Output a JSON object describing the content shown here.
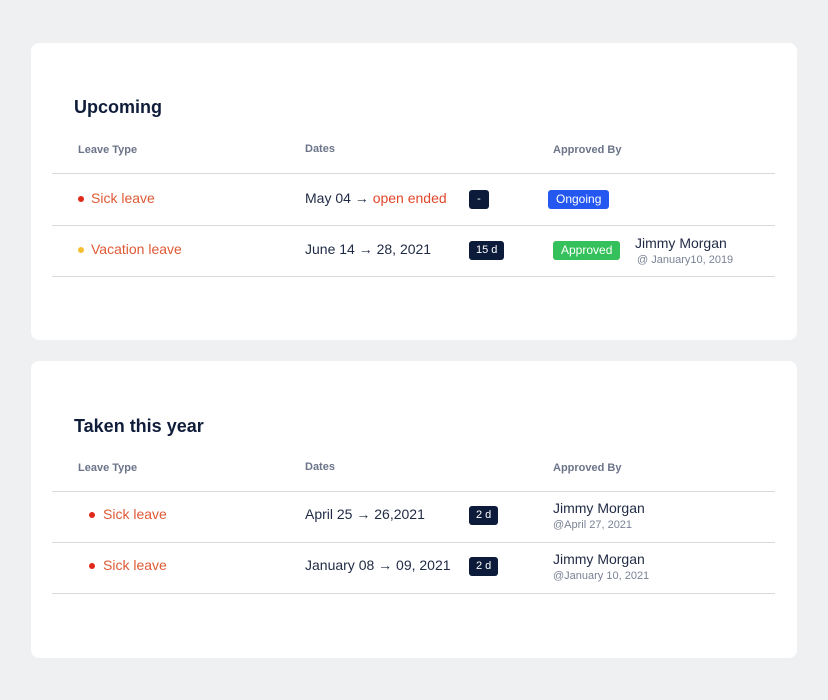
{
  "colors": {
    "background": "#eff0f2",
    "card": "#ffffff",
    "title": "#0f1d3a",
    "leave_type_text": "#de5a35",
    "open_ended": "#e2472c",
    "dot_sick": "#e0291b",
    "dot_vacation": "#f5c02f",
    "duration_badge": "#0d1b3a",
    "status_ongoing": "#2458f0",
    "status_approved": "#34c05a"
  },
  "upcoming": {
    "title": "Upcoming",
    "headers": {
      "leave_type": "Leave Type",
      "dates": "Dates",
      "approved_by": "Approved By"
    },
    "rows": [
      {
        "leave_type": "Sick leave",
        "dot": "red",
        "date_start": "May 04 → ",
        "date_end": "open ended",
        "duration": "-",
        "status": "Ongoing",
        "approver_name": "",
        "approver_date": ""
      },
      {
        "leave_type": "Vacation leave",
        "dot": "yellow",
        "date_start": "June 14 → 28, 2021",
        "date_end": "",
        "duration": "15 d",
        "status": "Approved",
        "approver_name": "Jimmy Morgan",
        "approver_date": "@ January10,  2019"
      }
    ]
  },
  "taken": {
    "title": "Taken this year",
    "headers": {
      "leave_type": "Leave Type",
      "dates": "Dates",
      "approved_by": "Approved By"
    },
    "rows": [
      {
        "leave_type": "Sick leave",
        "dot": "red",
        "dates": "April 25 → 26,2021",
        "duration": "2 d",
        "approver_name": "Jimmy Morgan",
        "approver_date": "@April 27,  2021"
      },
      {
        "leave_type": "Sick leave",
        "dot": "red",
        "dates": "January 08 → 09, 2021",
        "duration": "2 d",
        "approver_name": "Jimmy Morgan",
        "approver_date": "@January 10,  2021"
      }
    ]
  }
}
